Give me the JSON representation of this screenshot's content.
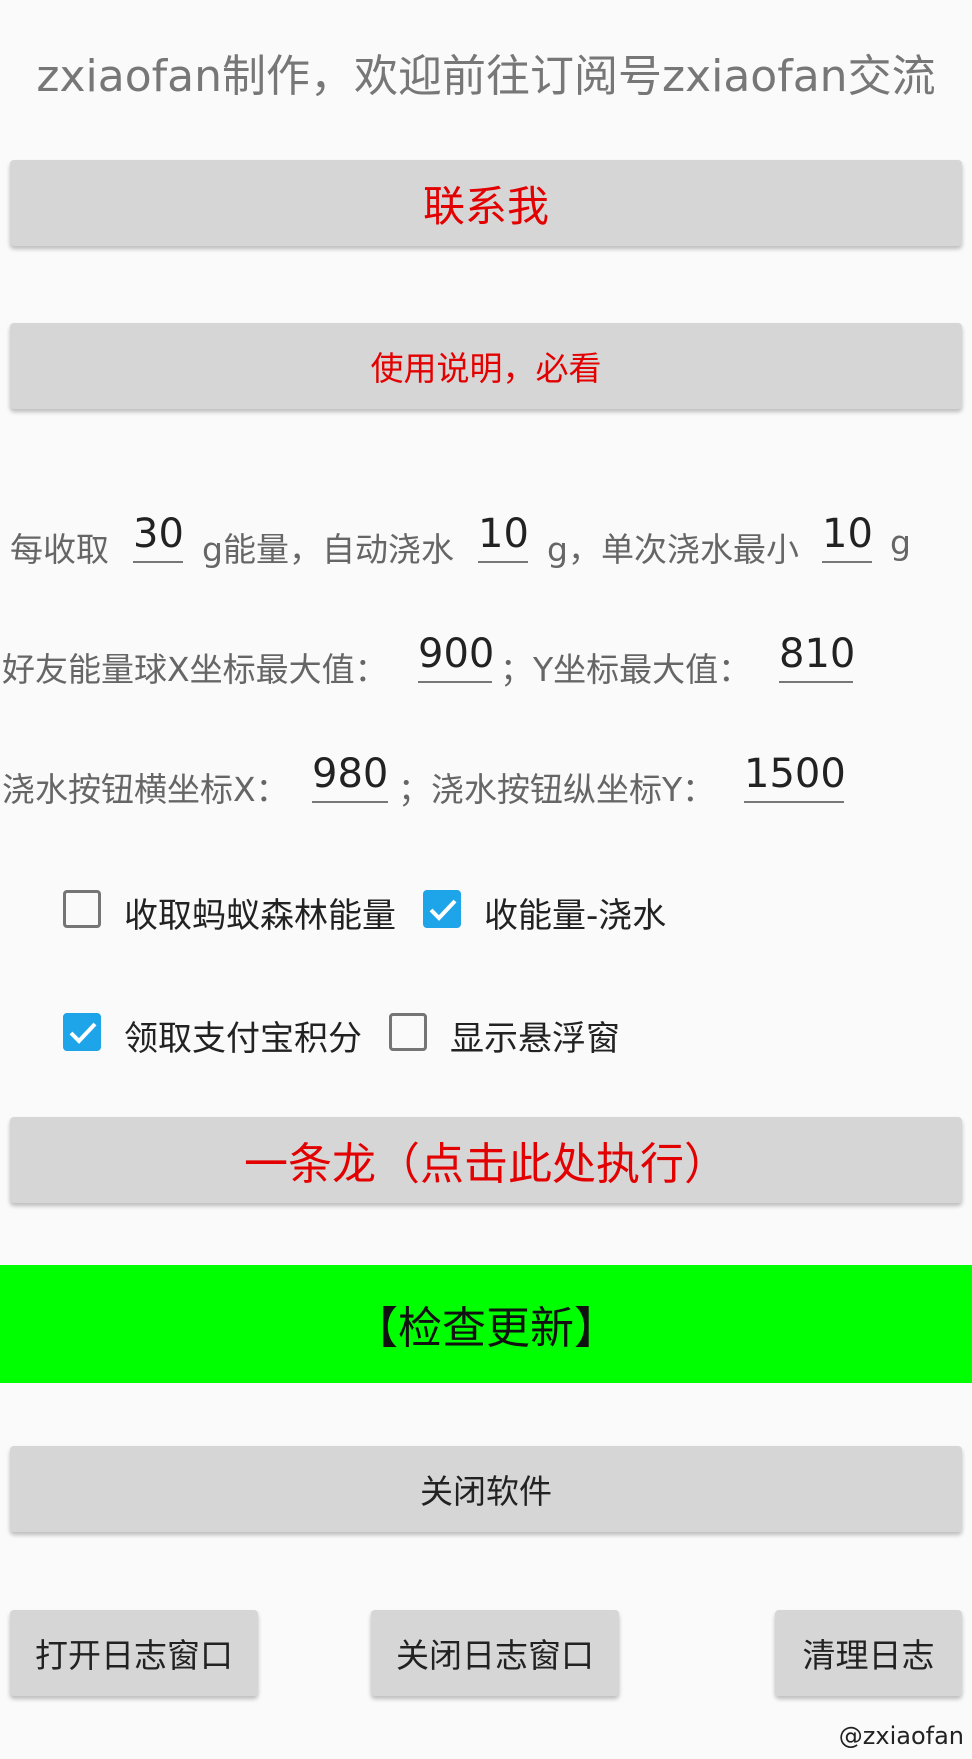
{
  "header": {
    "title": "zxiaofan制作，欢迎前往订阅号zxiaofan交流"
  },
  "buttons": {
    "contact": "联系我",
    "instructions": "使用说明，必看",
    "run_all": "一条龙（点击此处执行）",
    "check_update": "【检查更新】",
    "close_app": "关闭软件",
    "open_log": "打开日志窗口",
    "close_log": "关闭日志窗口",
    "clear_log": "清理日志"
  },
  "settings": {
    "row1": {
      "prefix": "每收取",
      "energy_value": "30",
      "mid": "g能量，自动浇水",
      "water_value": "10",
      "mid2": "g，单次浇水最小",
      "min_water_value": "10",
      "suffix": "g"
    },
    "row2": {
      "label_x": "好友能量球X坐标最大值：",
      "x_value": "900",
      "label_y": "；Y坐标最大值：",
      "y_value": "810"
    },
    "row3": {
      "label_x": "浇水按钮横坐标X：",
      "x_value": "980",
      "label_y": "；浇水按钮纵坐标Y：",
      "y_value": "1500"
    }
  },
  "checkboxes": [
    {
      "label": "收取蚂蚁森林能量",
      "checked": false
    },
    {
      "label": "收能量-浇水",
      "checked": true
    },
    {
      "label": "领取支付宝积分",
      "checked": true
    },
    {
      "label": "显示悬浮窗",
      "checked": false
    }
  ],
  "footer": {
    "watermark": "@zxiaofan"
  },
  "colors": {
    "accent_red": "#e30000",
    "update_green": "#00ff00",
    "checkbox_blue": "#1ea4e9"
  }
}
